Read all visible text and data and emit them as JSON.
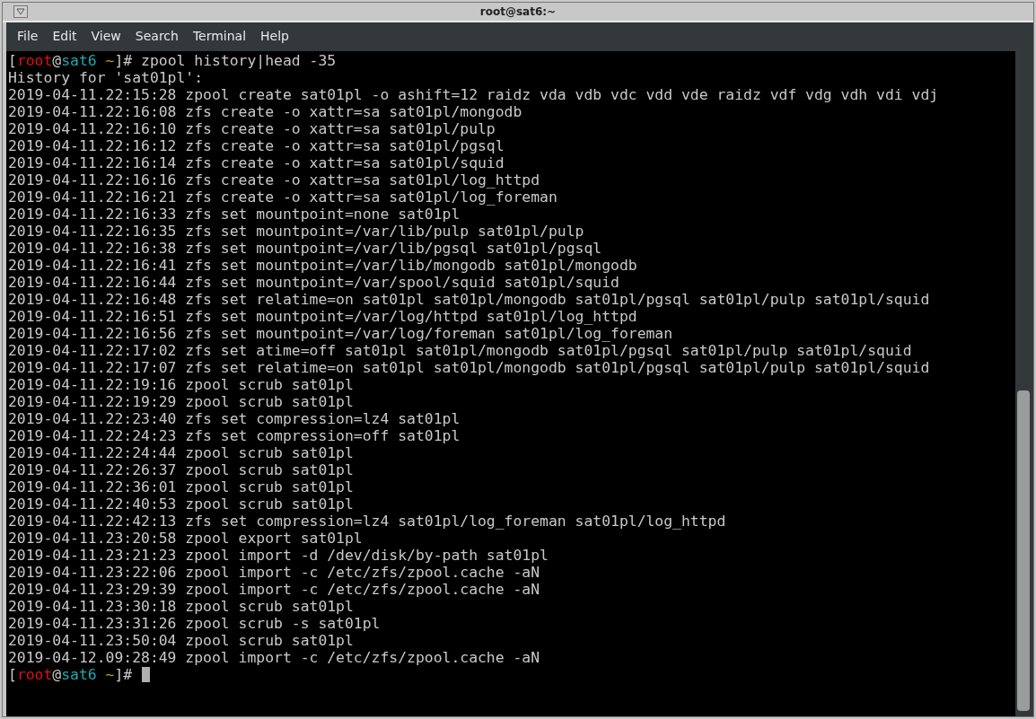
{
  "window": {
    "title": "root@sat6:~"
  },
  "menu": [
    "File",
    "Edit",
    "View",
    "Search",
    "Terminal",
    "Help"
  ],
  "lines": [
    {
      "kind": "prompt",
      "open": "[",
      "user": "root",
      "at": "@",
      "host": "sat6",
      "path": "~",
      "close": "]#",
      "command": "zpool history|head -35",
      "cursor": false
    },
    {
      "kind": "output",
      "text": "History for 'sat01pl':"
    },
    {
      "kind": "output",
      "text": "2019-04-11.22:15:28 zpool create sat01pl -o ashift=12 raidz vda vdb vdc vdd vde raidz vdf vdg vdh vdi vdj"
    },
    {
      "kind": "output",
      "text": "2019-04-11.22:16:08 zfs create -o xattr=sa sat01pl/mongodb"
    },
    {
      "kind": "output",
      "text": "2019-04-11.22:16:10 zfs create -o xattr=sa sat01pl/pulp"
    },
    {
      "kind": "output",
      "text": "2019-04-11.22:16:12 zfs create -o xattr=sa sat01pl/pgsql"
    },
    {
      "kind": "output",
      "text": "2019-04-11.22:16:14 zfs create -o xattr=sa sat01pl/squid"
    },
    {
      "kind": "output",
      "text": "2019-04-11.22:16:16 zfs create -o xattr=sa sat01pl/log_httpd"
    },
    {
      "kind": "output",
      "text": "2019-04-11.22:16:21 zfs create -o xattr=sa sat01pl/log_foreman"
    },
    {
      "kind": "output",
      "text": "2019-04-11.22:16:33 zfs set mountpoint=none sat01pl"
    },
    {
      "kind": "output",
      "text": "2019-04-11.22:16:35 zfs set mountpoint=/var/lib/pulp sat01pl/pulp"
    },
    {
      "kind": "output",
      "text": "2019-04-11.22:16:38 zfs set mountpoint=/var/lib/pgsql sat01pl/pgsql"
    },
    {
      "kind": "output",
      "text": "2019-04-11.22:16:41 zfs set mountpoint=/var/lib/mongodb sat01pl/mongodb"
    },
    {
      "kind": "output",
      "text": "2019-04-11.22:16:44 zfs set mountpoint=/var/spool/squid sat01pl/squid"
    },
    {
      "kind": "output",
      "text": "2019-04-11.22:16:48 zfs set relatime=on sat01pl sat01pl/mongodb sat01pl/pgsql sat01pl/pulp sat01pl/squid"
    },
    {
      "kind": "output",
      "text": "2019-04-11.22:16:51 zfs set mountpoint=/var/log/httpd sat01pl/log_httpd"
    },
    {
      "kind": "output",
      "text": "2019-04-11.22:16:56 zfs set mountpoint=/var/log/foreman sat01pl/log_foreman"
    },
    {
      "kind": "output",
      "text": "2019-04-11.22:17:02 zfs set atime=off sat01pl sat01pl/mongodb sat01pl/pgsql sat01pl/pulp sat01pl/squid"
    },
    {
      "kind": "output",
      "text": "2019-04-11.22:17:07 zfs set relatime=on sat01pl sat01pl/mongodb sat01pl/pgsql sat01pl/pulp sat01pl/squid"
    },
    {
      "kind": "output",
      "text": "2019-04-11.22:19:16 zpool scrub sat01pl"
    },
    {
      "kind": "output",
      "text": "2019-04-11.22:19:29 zpool scrub sat01pl"
    },
    {
      "kind": "output",
      "text": "2019-04-11.22:23:40 zfs set compression=lz4 sat01pl"
    },
    {
      "kind": "output",
      "text": "2019-04-11.22:24:23 zfs set compression=off sat01pl"
    },
    {
      "kind": "output",
      "text": "2019-04-11.22:24:44 zpool scrub sat01pl"
    },
    {
      "kind": "output",
      "text": "2019-04-11.22:26:37 zpool scrub sat01pl"
    },
    {
      "kind": "output",
      "text": "2019-04-11.22:36:01 zpool scrub sat01pl"
    },
    {
      "kind": "output",
      "text": "2019-04-11.22:40:53 zpool scrub sat01pl"
    },
    {
      "kind": "output",
      "text": "2019-04-11.22:42:13 zfs set compression=lz4 sat01pl/log_foreman sat01pl/log_httpd"
    },
    {
      "kind": "output",
      "text": "2019-04-11.23:20:58 zpool export sat01pl"
    },
    {
      "kind": "output",
      "text": "2019-04-11.23:21:23 zpool import -d /dev/disk/by-path sat01pl"
    },
    {
      "kind": "output",
      "text": "2019-04-11.23:22:06 zpool import -c /etc/zfs/zpool.cache -aN"
    },
    {
      "kind": "output",
      "text": "2019-04-11.23:29:39 zpool import -c /etc/zfs/zpool.cache -aN"
    },
    {
      "kind": "output",
      "text": "2019-04-11.23:30:18 zpool scrub sat01pl"
    },
    {
      "kind": "output",
      "text": "2019-04-11.23:31:26 zpool scrub -s sat01pl"
    },
    {
      "kind": "output",
      "text": "2019-04-11.23:50:04 zpool scrub sat01pl"
    },
    {
      "kind": "output",
      "text": "2019-04-12.09:28:49 zpool import -c /etc/zfs/zpool.cache -aN"
    },
    {
      "kind": "prompt",
      "open": "[",
      "user": "root",
      "at": "@",
      "host": "sat6",
      "path": "~",
      "close": "]#",
      "cursor": true
    }
  ]
}
